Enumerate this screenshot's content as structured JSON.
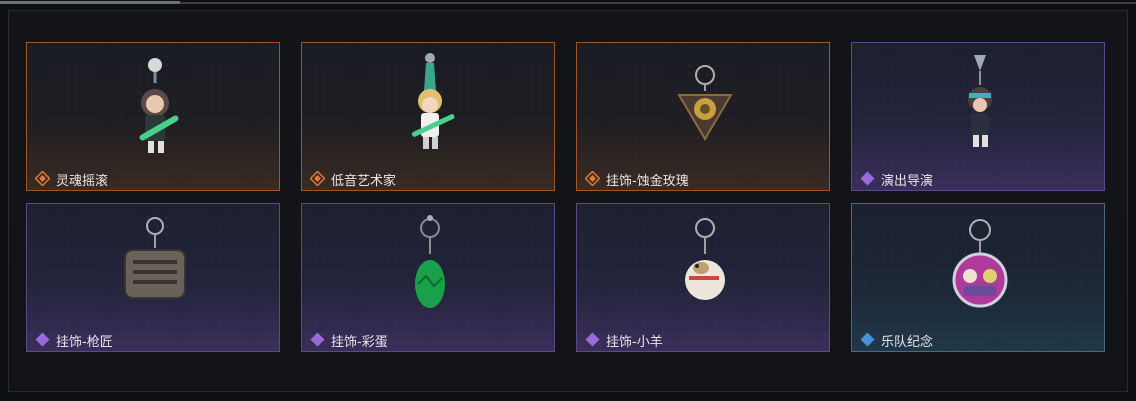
{
  "colors": {
    "legendary": "#e07a3a",
    "epic": "#9a6ad8",
    "rare": "#4a90d8"
  },
  "items": [
    {
      "name": "灵魂摇滚",
      "rarity": "legendary",
      "icon": "rocker-guitar-charm-icon"
    },
    {
      "name": "低音艺术家",
      "rarity": "legendary",
      "icon": "bassist-charm-icon"
    },
    {
      "name": "挂饰-蚀金玫瑰",
      "rarity": "legendary",
      "icon": "gilded-rose-charm-icon"
    },
    {
      "name": "演出导演",
      "rarity": "epic",
      "icon": "director-charm-icon"
    },
    {
      "name": "挂饰-枪匠",
      "rarity": "epic",
      "icon": "gunsmith-case-charm-icon"
    },
    {
      "name": "挂饰-彩蛋",
      "rarity": "epic",
      "icon": "green-egg-charm-icon"
    },
    {
      "name": "挂饰-小羊",
      "rarity": "epic",
      "icon": "sheep-charm-icon"
    },
    {
      "name": "乐队纪念",
      "rarity": "rare",
      "icon": "band-badge-charm-icon"
    }
  ]
}
